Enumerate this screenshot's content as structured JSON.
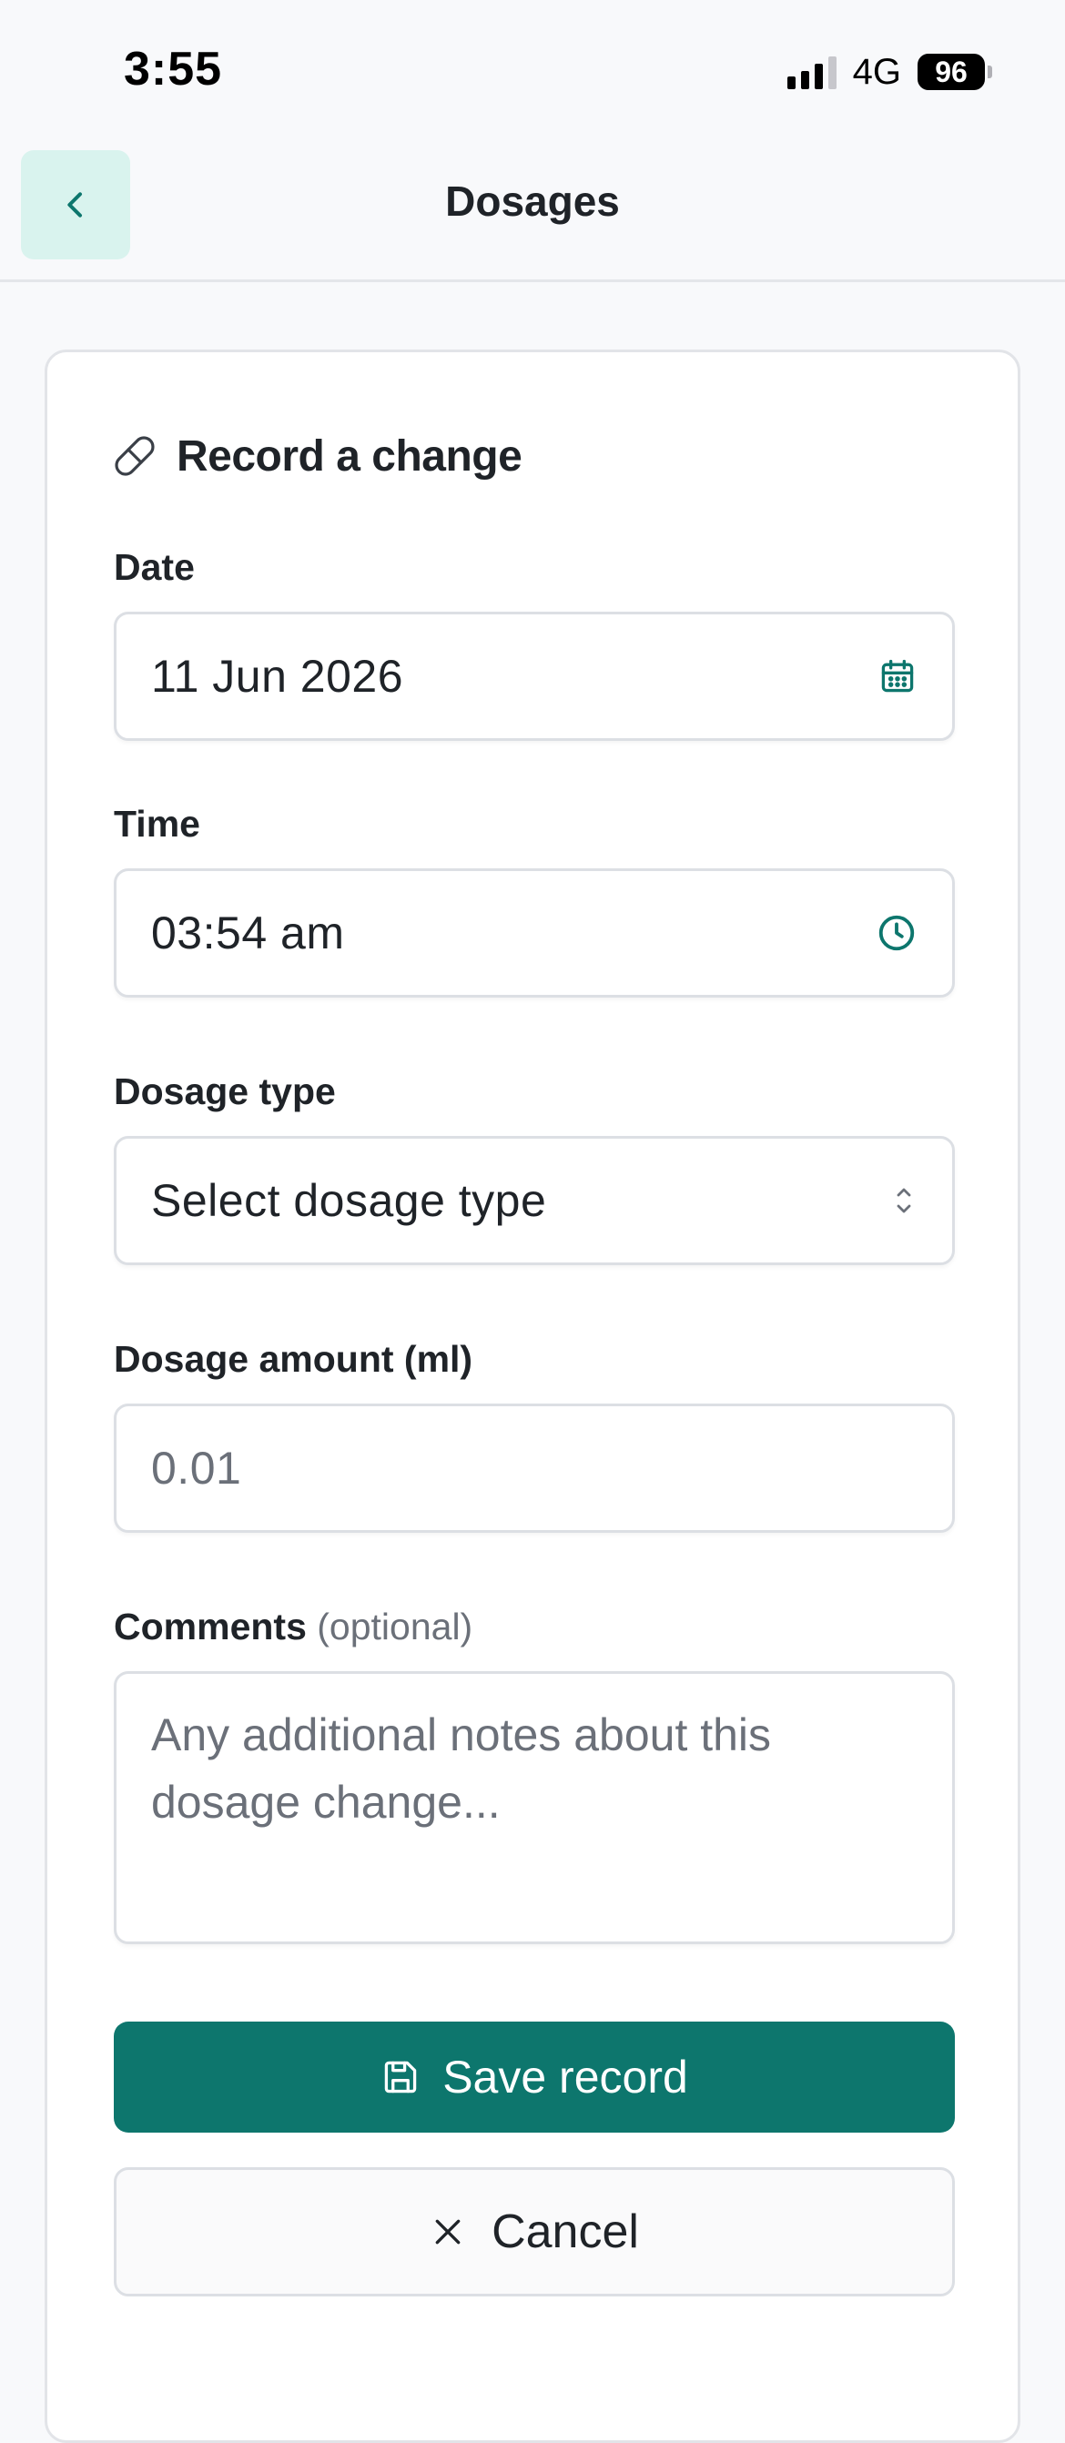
{
  "status_bar": {
    "time": "3:55",
    "network": "4G",
    "battery": "96"
  },
  "header": {
    "title": "Dosages",
    "back_icon": "chevron-left-icon"
  },
  "form": {
    "title": "Record a change",
    "title_icon": "pill-icon",
    "date": {
      "label": "Date",
      "value": "11 Jun 2026",
      "icon": "calendar-icon"
    },
    "time": {
      "label": "Time",
      "value": "03:54 am",
      "icon": "clock-icon"
    },
    "dosage_type": {
      "label": "Dosage type",
      "placeholder": "Select dosage type",
      "icon": "chevron-up-down-icon"
    },
    "dosage_amount": {
      "label": "Dosage amount (ml)",
      "placeholder": "0.01"
    },
    "comments": {
      "label": "Comments",
      "optional": "(optional)",
      "placeholder": "Any additional notes about this dosage change..."
    },
    "save_label": "Save record",
    "save_icon": "save-icon",
    "cancel_label": "Cancel",
    "cancel_icon": "close-icon"
  },
  "colors": {
    "accent": "#0d766d",
    "back_button_bg": "#d9f3ee"
  }
}
